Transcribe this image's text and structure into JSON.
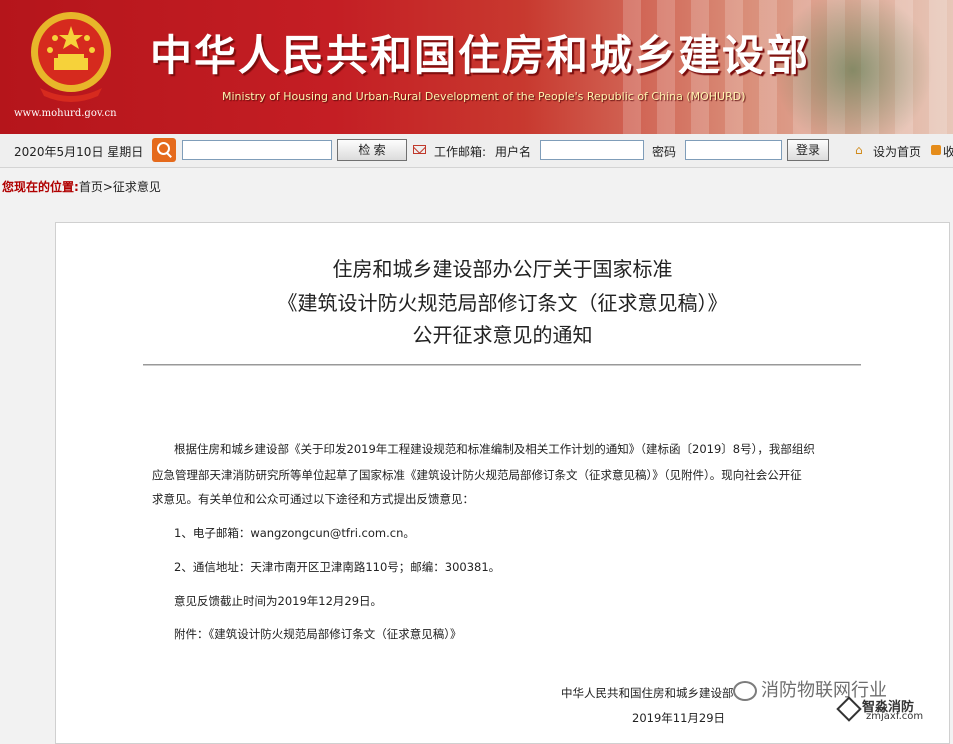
{
  "header": {
    "site_title": "中华人民共和国住房和城乡建设部",
    "site_title_en": "Ministry of Housing and Urban-Rural Development of the People's Republic of China (MOHURD)",
    "site_url": "www.mohurd.gov.cn"
  },
  "toolbar": {
    "date": "2020年5月10日  星期日",
    "search_value": "",
    "search_button": "检  索",
    "mailbox_label": "工作邮箱:",
    "username_label": "用户名",
    "username_value": "",
    "password_label": "密码",
    "password_value": "",
    "login_button": "登录",
    "set_home": "设为首页",
    "favorite": "收"
  },
  "breadcrumb": {
    "label": "您现在的位置:",
    "path": "首页>征求意见"
  },
  "article": {
    "title_lines": [
      "住房和城乡建设部办公厅关于国家标准",
      "《建筑设计防火规范局部修订条文（征求意见稿）》",
      "公开征求意见的通知"
    ],
    "body_lines": [
      "根据住房和城乡建设部《关于印发2019年工程建设规范和标准编制及相关工作计划的通知》（建标函〔2019〕8号），我部组织",
      "应急管理部天津消防研究所等单位起草了国家标准《建筑设计防火规范局部修订条文（征求意见稿）》（见附件）。现向社会公开征",
      "求意见。有关单位和公众可通过以下途径和方式提出反馈意见："
    ],
    "item1": "1、电子邮箱：wangzongcun@tfri.com.cn。",
    "item2": "2、通信地址：天津市南开区卫津南路110号；邮编：300381。",
    "deadline": "意见反馈截止时间为2019年12月29日。",
    "attachment": "附件：《建筑设计防火规范局部修订条文（征求意见稿）》",
    "signature": "中华人民共和国住房和城乡建设部",
    "date": "2019年11月29日"
  },
  "watermark": {
    "text": "消防物联网行业",
    "brand": "智淼消防",
    "brand_url": "zmjaxf.com"
  },
  "colors": {
    "banner_red": "#c41e24",
    "crumb_red": "#b00000",
    "search_orange": "#e56a1c"
  }
}
